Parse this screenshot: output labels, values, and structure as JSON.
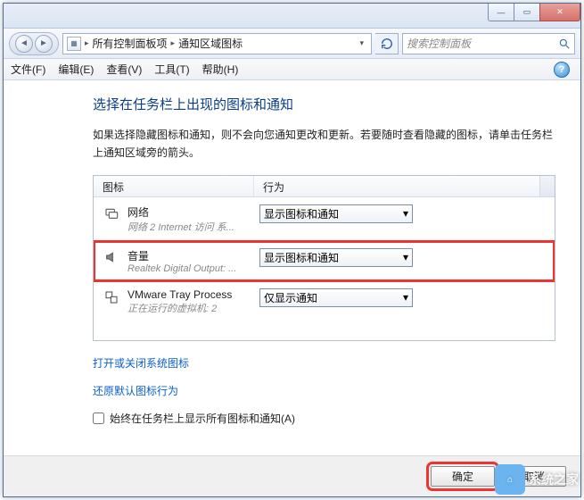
{
  "titlebar": {
    "min": "—",
    "max": "▭",
    "close": "✕"
  },
  "nav": {
    "back": "◄",
    "fwd": "►",
    "crumb1": "所有控制面板项",
    "crumb2": "通知区域图标",
    "refresh": "↻",
    "search_placeholder": "搜索控制面板"
  },
  "menu": {
    "file": "文件(F)",
    "edit": "编辑(E)",
    "view": "查看(V)",
    "tools": "工具(T)",
    "help": "帮助(H)",
    "help_icon": "?"
  },
  "page": {
    "heading": "选择在任务栏上出现的图标和通知",
    "desc": "如果选择隐藏图标和通知，则不会向您通知更改和更新。若要随时查看隐藏的图标，请单击任务栏上通知区域旁的箭头。"
  },
  "list": {
    "col_icon": "图标",
    "col_behavior": "行为",
    "items": [
      {
        "name": "网络",
        "sub": "网络 2 Internet 访问 系...",
        "behavior": "显示图标和通知"
      },
      {
        "name": "音量",
        "sub": "Realtek Digital Output: ...",
        "behavior": "显示图标和通知"
      },
      {
        "name": "VMware Tray Process",
        "sub": "正在运行的虚拟机: 2",
        "behavior": "仅显示通知"
      }
    ]
  },
  "links": {
    "toggle_system": "打开或关闭系统图标",
    "restore": "还原默认图标行为"
  },
  "checkbox": {
    "label": "始终在任务栏上显示所有图标和通知(A)"
  },
  "buttons": {
    "ok": "确定",
    "cancel": "取消"
  },
  "watermark": "系统之家"
}
